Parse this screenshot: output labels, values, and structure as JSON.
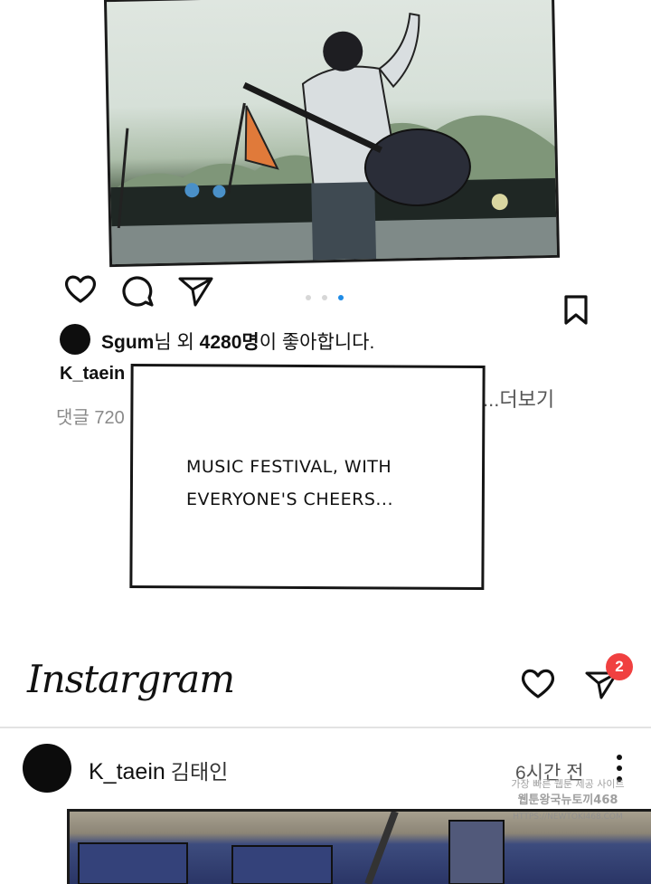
{
  "post1": {
    "carousel": {
      "count": 3,
      "active_index": 2
    },
    "likes": {
      "user": "Sgum",
      "text_mid": "님 외 ",
      "count": "4280명",
      "text_end": "이 좋아합니다."
    },
    "caption_user": "K_taein",
    "more_label": "...더보기",
    "comments_label": "댓글 720"
  },
  "speech": {
    "line1": "Music festival, with",
    "line2": "everyone's cheers..."
  },
  "header": {
    "brand": "Instargram",
    "dm_badge": "2"
  },
  "post2": {
    "username": "K_taein",
    "display_name": "김태인",
    "time": "6시간 전"
  },
  "watermark": {
    "line1": "가장 빠른 웹툰 제공 사이트",
    "line2": "웹툰왕국뉴토끼468",
    "line3": "HTTPS://NEWTOKI468.COM"
  },
  "colors": {
    "carousel_active": "#1e8be6",
    "badge": "#f04040"
  },
  "icons": [
    "heart-icon",
    "comment-icon",
    "send-icon",
    "bookmark-icon",
    "more-vertical-icon"
  ]
}
